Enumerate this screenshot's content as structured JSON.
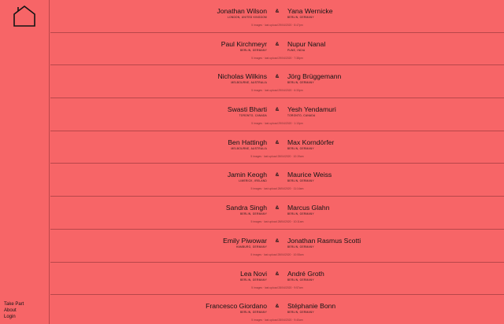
{
  "sidebar": {
    "logo_icon": "house-outline-icon",
    "nav": [
      {
        "label": "Take Part"
      },
      {
        "label": "About"
      },
      {
        "label": "Login"
      }
    ]
  },
  "connector": "&",
  "pairs": [
    {
      "left": {
        "name": "Jonathan Wilson",
        "location": "LONDON, UNITED KINGDOM"
      },
      "right": {
        "name": "Yana Wernicke",
        "location": "BERLIN, GERMANY"
      },
      "meta": "5 images · last upload 29/04/2020 · 8:47pm"
    },
    {
      "left": {
        "name": "Paul Kirchmeyr",
        "location": "BERLIN, GERMANY"
      },
      "right": {
        "name": "Nupur Nanal",
        "location": "PUNE, INDIA"
      },
      "meta": "5 images · last upload 29/04/2020 · 7:38pm"
    },
    {
      "left": {
        "name": "Nicholas Wilkins",
        "location": "MELBOURNE, AUSTRALIA"
      },
      "right": {
        "name": "Jörg Brüggemann",
        "location": "BERLIN, GERMANY"
      },
      "meta": "5 images · last upload 29/04/2020 · 6:33pm"
    },
    {
      "left": {
        "name": "Swasti Bharti",
        "location": "TORONTO, CANADA"
      },
      "right": {
        "name": "Yesh Yendamuri",
        "location": "TORONTO, CANADA"
      },
      "meta": "5 images · last upload 29/04/2020 · 1:13pm"
    },
    {
      "left": {
        "name": "Ben Hattingh",
        "location": "MELBOURNE, AUSTRALIA"
      },
      "right": {
        "name": "Max Korndörfer",
        "location": "BERLIN, GERMANY"
      },
      "meta": "5 images · last upload 28/04/2020 · 10:19am"
    },
    {
      "left": {
        "name": "Jamin Keogh",
        "location": "LIMERICK, IRELAND"
      },
      "right": {
        "name": "Maurice Weiss",
        "location": "BERLIN, GERMANY"
      },
      "meta": "5 images · last upload 28/04/2020 · 11:14am"
    },
    {
      "left": {
        "name": "Sandra Singh",
        "location": "BERLIN, GERMANY"
      },
      "right": {
        "name": "Marcus Glahn",
        "location": "BERLIN, GERMANY"
      },
      "meta": "5 images · last upload 28/04/2020 · 10:11am"
    },
    {
      "left": {
        "name": "Emily Piwowar",
        "location": "HAMBURG, GERMANY"
      },
      "right": {
        "name": "Jonathan Rasmus Scotti",
        "location": "BERLIN, GERMANY"
      },
      "meta": "5 images · last upload 28/04/2020 · 10:08am"
    },
    {
      "left": {
        "name": "Lea Novi",
        "location": "BERLIN, GERMANY"
      },
      "right": {
        "name": "André Groth",
        "location": "BERLIN, GERMANY"
      },
      "meta": "5 images · last upload 28/04/2020 · 9:57am"
    },
    {
      "left": {
        "name": "Francesco Giordano",
        "location": "BERLIN, GERMANY"
      },
      "right": {
        "name": "Stéphanie Bonn",
        "location": "BERLIN, GERMANY"
      },
      "meta": "5 images · last upload 28/04/2020 · 9:40am"
    }
  ]
}
